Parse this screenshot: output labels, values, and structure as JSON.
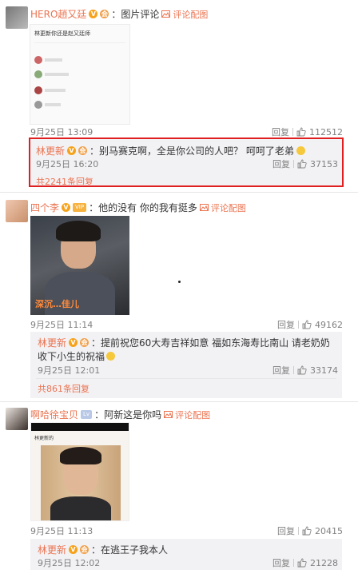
{
  "c1": {
    "user": "HERO趙又廷",
    "text": "：图片评论",
    "link": "评论配图",
    "time": "9月25日 13:09",
    "reply": "回复",
    "likes": "112512",
    "img_lines": [
      "林更新你还是赵又廷师"
    ]
  },
  "r1": {
    "user": "林更新",
    "text": "：别马赛克啊，全是你公司的人吧？ 呵呵了老弟",
    "time": "9月25日 16:20",
    "reply": "回复",
    "likes": "37153",
    "more": "共2241条回复"
  },
  "c2": {
    "user": "四个李",
    "text": "：他的没有 你的我有挺多",
    "link": "评论配图",
    "time": "9月25日 11:14",
    "reply": "回复",
    "likes": "49162",
    "img_caption": "深沉…佳儿"
  },
  "r2": {
    "user": "林更新",
    "text1": "：提前祝您60大寿吉祥如意 福如东海寿比南山 请老奶奶",
    "text2": "收下小生的祝福",
    "time": "9月25日 12:01",
    "reply": "回复",
    "likes": "33174",
    "more": "共861条回复"
  },
  "c3": {
    "user": "啊哈徐宝贝",
    "text": "：阿新这是你吗",
    "link": "评论配图",
    "time": "9月25日 11:13",
    "reply": "回复",
    "likes": "20415",
    "img_caption": "林更新的"
  },
  "r3": {
    "user": "林更新",
    "text": "：在逃王子我本人",
    "time": "9月25日 12:02",
    "reply": "回复",
    "likes": "21228"
  },
  "colors": {
    "accent": "#eb7350",
    "highlight_border": "#e02020"
  }
}
